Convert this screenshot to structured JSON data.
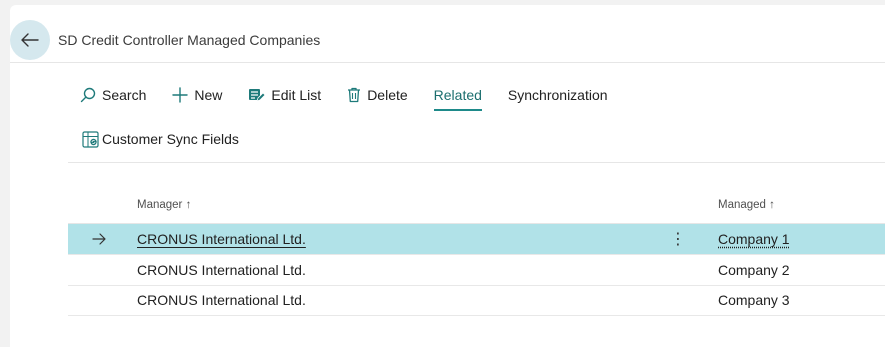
{
  "page": {
    "title": "SD Credit Controller Managed Companies"
  },
  "actions": {
    "search": "Search",
    "new": "New",
    "edit_list": "Edit List",
    "delete": "Delete",
    "related": "Related",
    "synchronization": "Synchronization",
    "customer_sync_fields": "Customer Sync Fields"
  },
  "table": {
    "columns": [
      {
        "label": "Manager",
        "sort": "↑"
      },
      {
        "label": "Managed",
        "sort": "↑"
      }
    ],
    "rows": [
      {
        "manager": "CRONUS International Ltd.",
        "managed": "Company 1"
      },
      {
        "manager": "CRONUS International Ltd.",
        "managed": "Company 2"
      },
      {
        "manager": "CRONUS International Ltd.",
        "managed": "Company 3"
      }
    ],
    "selected_row_marker": "→",
    "row_menu_glyph": "⋮"
  },
  "icons": {
    "back": "arrow-left-icon",
    "search": "magnifier-icon",
    "new": "plus-icon",
    "edit_list": "edit-list-icon",
    "delete": "trash-icon",
    "customer_sync_fields": "sync-fields-icon"
  },
  "colors": {
    "accent": "#1e8a8a",
    "selected_row": "#b1e2e8",
    "back_circle": "#d5e8ee"
  }
}
